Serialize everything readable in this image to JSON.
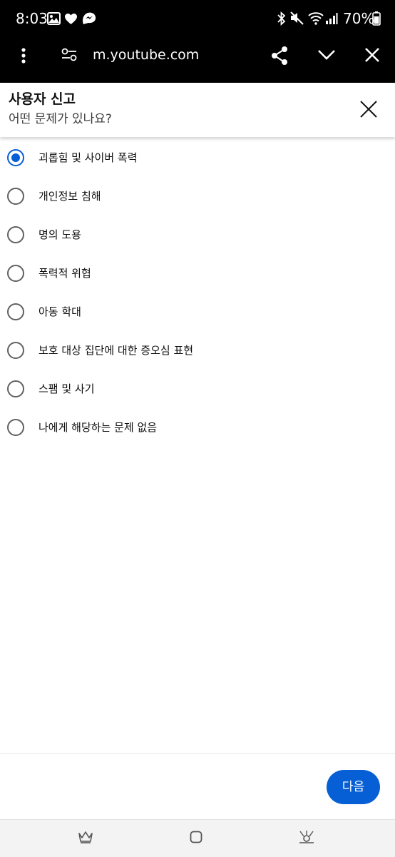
{
  "status_bar": {
    "time": "8:03",
    "battery": "70%",
    "icons": [
      "gallery-icon",
      "heart-icon",
      "messenger-icon",
      "bluetooth-icon",
      "mute-icon",
      "wifi-icon",
      "signal-icon",
      "battery-icon"
    ]
  },
  "browser": {
    "url": "m.youtube.com",
    "icons": [
      "menu-icon",
      "site-settings-icon",
      "share-icon",
      "chevron-down-icon",
      "close-icon"
    ]
  },
  "report": {
    "title": "사용자 신고",
    "subtitle": "어떤 문제가 있나요?",
    "options": [
      {
        "label": "괴롭힘 및 사이버 폭력",
        "selected": true
      },
      {
        "label": "개인정보 침해",
        "selected": false
      },
      {
        "label": "명의 도용",
        "selected": false
      },
      {
        "label": "폭력적 위협",
        "selected": false
      },
      {
        "label": "아동 학대",
        "selected": false
      },
      {
        "label": "보호 대상 집단에 대한 증오심 표현",
        "selected": false
      },
      {
        "label": "스팸 및 사기",
        "selected": false
      },
      {
        "label": "나에게 해당하는 문제 없음",
        "selected": false
      }
    ],
    "next_label": "다음"
  },
  "colors": {
    "accent": "#065fd4",
    "radio_border": "#606060",
    "topbar": "#000000"
  }
}
